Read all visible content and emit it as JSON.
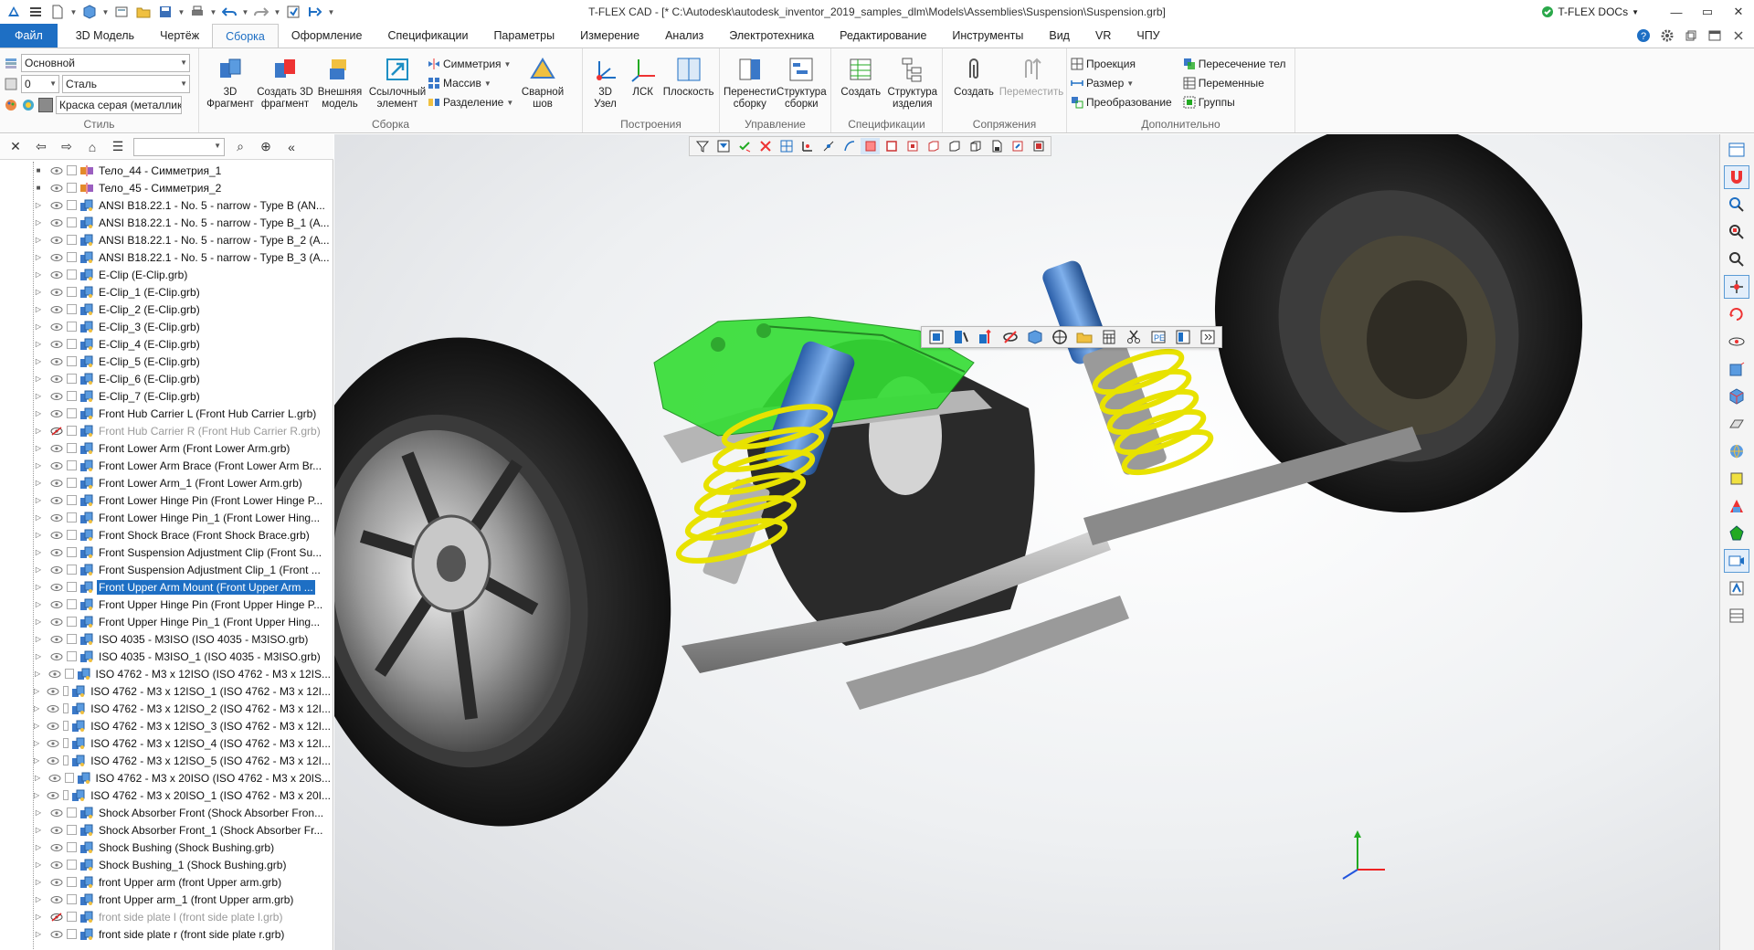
{
  "window": {
    "title": "T-FLEX CAD - [* C:\\Autodesk\\autodesk_inventor_2019_samples_dlm\\Models\\Assemblies\\Suspension\\Suspension.grb]",
    "docs_label": "T-FLEX DOCs",
    "minimize": "—",
    "maximize": "▭",
    "close": "✕"
  },
  "tabs": [
    "Файл",
    "3D Модель",
    "Чертёж",
    "Сборка",
    "Оформление",
    "Спецификации",
    "Параметры",
    "Измерение",
    "Анализ",
    "Электротехника",
    "Редактирование",
    "Инструменты",
    "Вид",
    "VR",
    "ЧПУ"
  ],
  "active_tab": "Сборка",
  "style_group": {
    "title": "Стиль",
    "layer": "Основной",
    "level": "0",
    "material": "Сталь",
    "paint": "Краска серая (металлик)"
  },
  "assembly_group": {
    "title": "Сборка",
    "fragment3d": "3D\nФрагмент",
    "create_fragment": "Создать 3D\nфрагмент",
    "external_model": "Внешняя\nмодель",
    "ref_element": "Ссылочный\nэлемент",
    "symmetry": "Симметрия",
    "array": "Массив",
    "split": "Разделение",
    "weld": "Сварной\nшов"
  },
  "build_group": {
    "title": "Построения",
    "node3d": "3D\nУзел",
    "lsk": "ЛСК",
    "plane": "Плоскость"
  },
  "manage_group": {
    "title": "Управление",
    "move_assembly": "Перенести\nсборку",
    "structure": "Структура\nсборки"
  },
  "spec_group": {
    "title": "Спецификации",
    "create": "Создать",
    "product_structure": "Структура\nизделия"
  },
  "mates_group": {
    "title": "Сопряжения",
    "create": "Создать",
    "move": "Переместить"
  },
  "extra_group": {
    "title": "Дополнительно",
    "projection": "Проекция",
    "size": "Размер",
    "transform": "Преобразование",
    "body_intersection": "Пересечение тел",
    "variables": "Переменные",
    "groups": "Группы"
  },
  "tree": [
    {
      "label": "Тело_44 - Симметрия_1",
      "icon": "body",
      "exp": "■",
      "dim": false
    },
    {
      "label": "Тело_45 - Симметрия_2",
      "icon": "body",
      "exp": "■",
      "dim": false
    },
    {
      "label": "ANSI B18.22.1 - No. 5 - narrow - Type B (AN...",
      "icon": "part",
      "exp": "▷",
      "dim": false
    },
    {
      "label": "ANSI B18.22.1 - No. 5 - narrow - Type B_1 (A...",
      "icon": "part",
      "exp": "▷",
      "dim": false
    },
    {
      "label": "ANSI B18.22.1 - No. 5 - narrow - Type B_2 (A...",
      "icon": "part",
      "exp": "▷",
      "dim": false
    },
    {
      "label": "ANSI B18.22.1 - No. 5 - narrow - Type B_3 (A...",
      "icon": "part",
      "exp": "▷",
      "dim": false
    },
    {
      "label": "E-Clip (E-Clip.grb)",
      "icon": "part",
      "exp": "▷",
      "dim": false
    },
    {
      "label": "E-Clip_1 (E-Clip.grb)",
      "icon": "part",
      "exp": "▷",
      "dim": false
    },
    {
      "label": "E-Clip_2 (E-Clip.grb)",
      "icon": "part",
      "exp": "▷",
      "dim": false
    },
    {
      "label": "E-Clip_3 (E-Clip.grb)",
      "icon": "part",
      "exp": "▷",
      "dim": false
    },
    {
      "label": "E-Clip_4 (E-Clip.grb)",
      "icon": "part",
      "exp": "▷",
      "dim": false
    },
    {
      "label": "E-Clip_5 (E-Clip.grb)",
      "icon": "part",
      "exp": "▷",
      "dim": false
    },
    {
      "label": "E-Clip_6 (E-Clip.grb)",
      "icon": "part",
      "exp": "▷",
      "dim": false
    },
    {
      "label": "E-Clip_7 (E-Clip.grb)",
      "icon": "part",
      "exp": "▷",
      "dim": false
    },
    {
      "label": "Front Hub Carrier L (Front Hub Carrier L.grb)",
      "icon": "part",
      "exp": "▷",
      "dim": false
    },
    {
      "label": "Front Hub Carrier R (Front Hub Carrier R.grb)",
      "icon": "part",
      "exp": "▷",
      "dim": true,
      "hidden": true
    },
    {
      "label": "Front Lower Arm (Front Lower Arm.grb)",
      "icon": "part",
      "exp": "▷",
      "dim": false
    },
    {
      "label": "Front Lower Arm Brace (Front Lower Arm Br...",
      "icon": "part",
      "exp": "▷",
      "dim": false
    },
    {
      "label": "Front Lower Arm_1 (Front Lower Arm.grb)",
      "icon": "part",
      "exp": "▷",
      "dim": false
    },
    {
      "label": "Front Lower Hinge Pin (Front Lower Hinge P...",
      "icon": "part",
      "exp": "▷",
      "dim": false
    },
    {
      "label": "Front Lower Hinge Pin_1 (Front Lower Hing...",
      "icon": "part",
      "exp": "▷",
      "dim": false
    },
    {
      "label": "Front Shock Brace (Front Shock Brace.grb)",
      "icon": "part",
      "exp": "▷",
      "dim": false
    },
    {
      "label": "Front Suspension Adjustment Clip (Front Su...",
      "icon": "part",
      "exp": "▷",
      "dim": false
    },
    {
      "label": "Front Suspension Adjustment Clip_1 (Front ...",
      "icon": "part",
      "exp": "▷",
      "dim": false
    },
    {
      "label": "Front Upper Arm Mount (Front Upper Arm ...",
      "icon": "part",
      "exp": "▷",
      "dim": false,
      "selected": true
    },
    {
      "label": "Front Upper Hinge Pin (Front Upper Hinge P...",
      "icon": "part",
      "exp": "▷",
      "dim": false
    },
    {
      "label": "Front Upper Hinge Pin_1 (Front Upper Hing...",
      "icon": "part",
      "exp": "▷",
      "dim": false
    },
    {
      "label": "ISO 4035 - M3ISO (ISO 4035 - M3ISO.grb)",
      "icon": "part",
      "exp": "▷",
      "dim": false
    },
    {
      "label": "ISO 4035 - M3ISO_1 (ISO 4035 - M3ISO.grb)",
      "icon": "part",
      "exp": "▷",
      "dim": false
    },
    {
      "label": "ISO 4762 - M3 x 12ISO (ISO 4762 - M3 x 12IS...",
      "icon": "part",
      "exp": "▷",
      "dim": false
    },
    {
      "label": "ISO 4762 - M3 x 12ISO_1 (ISO 4762 - M3 x 12I...",
      "icon": "part",
      "exp": "▷",
      "dim": false
    },
    {
      "label": "ISO 4762 - M3 x 12ISO_2 (ISO 4762 - M3 x 12I...",
      "icon": "part",
      "exp": "▷",
      "dim": false
    },
    {
      "label": "ISO 4762 - M3 x 12ISO_3 (ISO 4762 - M3 x 12I...",
      "icon": "part",
      "exp": "▷",
      "dim": false
    },
    {
      "label": "ISO 4762 - M3 x 12ISO_4 (ISO 4762 - M3 x 12I...",
      "icon": "part",
      "exp": "▷",
      "dim": false
    },
    {
      "label": "ISO 4762 - M3 x 12ISO_5 (ISO 4762 - M3 x 12I...",
      "icon": "part",
      "exp": "▷",
      "dim": false
    },
    {
      "label": "ISO 4762 - M3 x 20ISO (ISO 4762 - M3 x 20IS...",
      "icon": "part",
      "exp": "▷",
      "dim": false
    },
    {
      "label": "ISO 4762 - M3 x 20ISO_1 (ISO 4762 - M3 x 20I...",
      "icon": "part",
      "exp": "▷",
      "dim": false
    },
    {
      "label": "Shock Absorber Front (Shock Absorber Fron...",
      "icon": "part",
      "exp": "▷",
      "dim": false
    },
    {
      "label": "Shock Absorber Front_1 (Shock Absorber Fr...",
      "icon": "part",
      "exp": "▷",
      "dim": false
    },
    {
      "label": "Shock Bushing (Shock Bushing.grb)",
      "icon": "part",
      "exp": "▷",
      "dim": false
    },
    {
      "label": "Shock Bushing_1 (Shock Bushing.grb)",
      "icon": "part",
      "exp": "▷",
      "dim": false
    },
    {
      "label": "front Upper arm (front Upper arm.grb)",
      "icon": "part",
      "exp": "▷",
      "dim": false
    },
    {
      "label": "front Upper arm_1 (front Upper arm.grb)",
      "icon": "part",
      "exp": "▷",
      "dim": false
    },
    {
      "label": "front side plate l (front side plate l.grb)",
      "icon": "part",
      "exp": "▷",
      "dim": true,
      "hidden": true
    },
    {
      "label": "front side plate r (front side plate r.grb)",
      "icon": "part",
      "exp": "▷",
      "dim": false
    }
  ],
  "colors": {
    "accent": "#1e6fc4",
    "selection": "#2ee02e",
    "spring": "#e8e200",
    "shock": "#3a78c8",
    "tire": "#1c1c1c"
  }
}
